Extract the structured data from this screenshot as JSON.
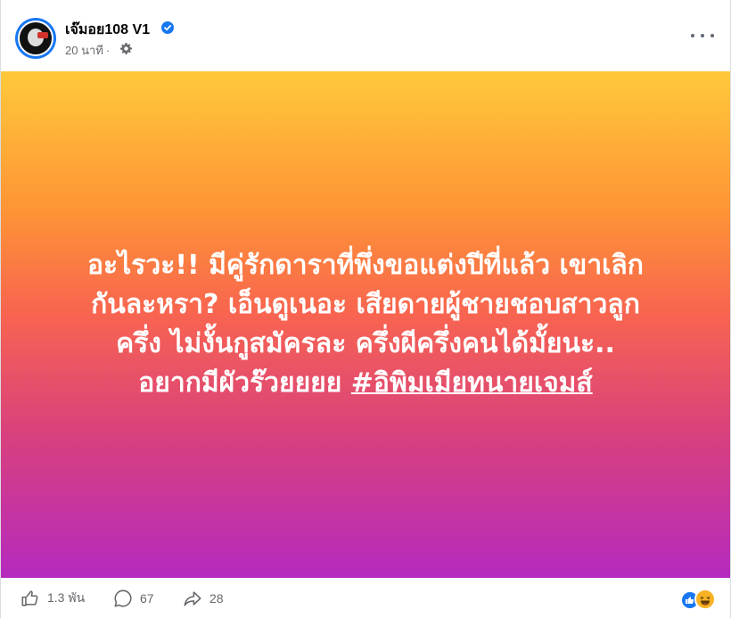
{
  "post": {
    "author": "เจ๊มอย108 V1",
    "time": "20 นาที",
    "privacy_icon": "gear-icon",
    "text_lines": [
      "อะไรวะ!! มีคู่รักดาราที่พึ่งขอแต่งปีที่แล้ว เขาเลิก",
      "กันละหรา? เอ็นดูเนอะ เสียดายผู้ชายชอบสาวลูก",
      "ครึ่ง ไม่งั้นกูสมัครละ ครึ่งผีครึ่งคนได้มั้ยนะ..",
      "อยากมีผัวร๊วยยยย "
    ],
    "hashtag": "#อิพิมเมียทนายเจมส์"
  },
  "footer": {
    "likes": "1.3 พัน",
    "comments": "67",
    "shares": "28"
  },
  "colors": {
    "gradient_top": "#ffc93a",
    "gradient_mid": "#f86450",
    "gradient_bottom": "#b52abf",
    "verified_blue": "#1877f2"
  }
}
